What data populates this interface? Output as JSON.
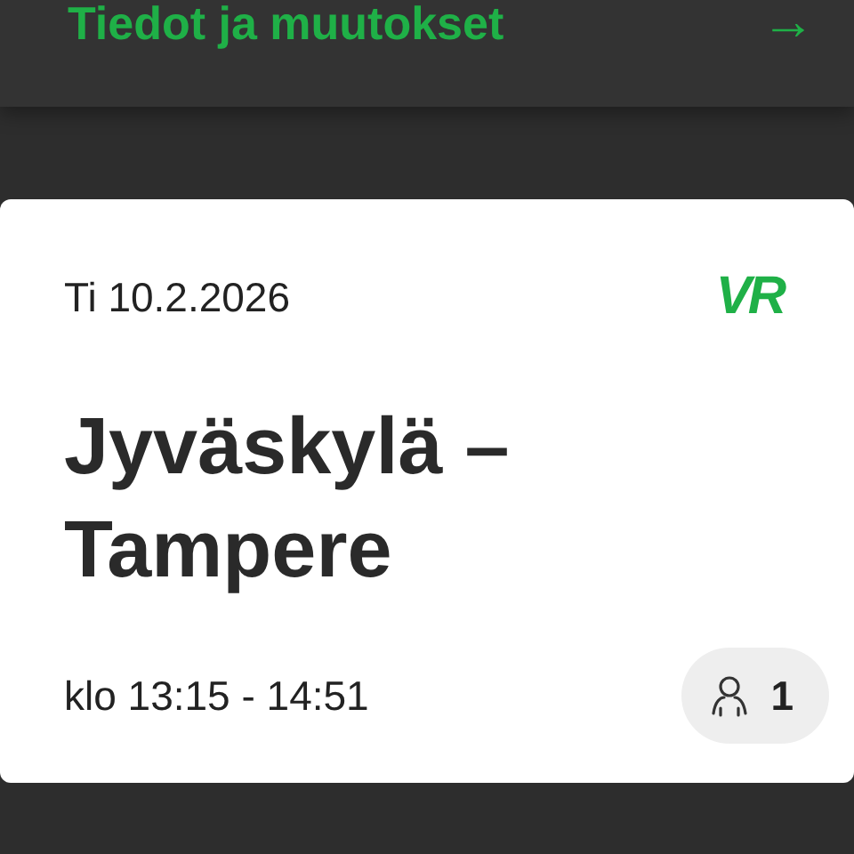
{
  "header": {
    "link": "Tiedot ja muutokset",
    "arrow": "→"
  },
  "ticket": {
    "date": "Ti 10.2.2026",
    "logo": "VR",
    "route": "Jyväskylä – Tampere",
    "time": "klo 13:15 - 14:51",
    "passengers": "1"
  }
}
